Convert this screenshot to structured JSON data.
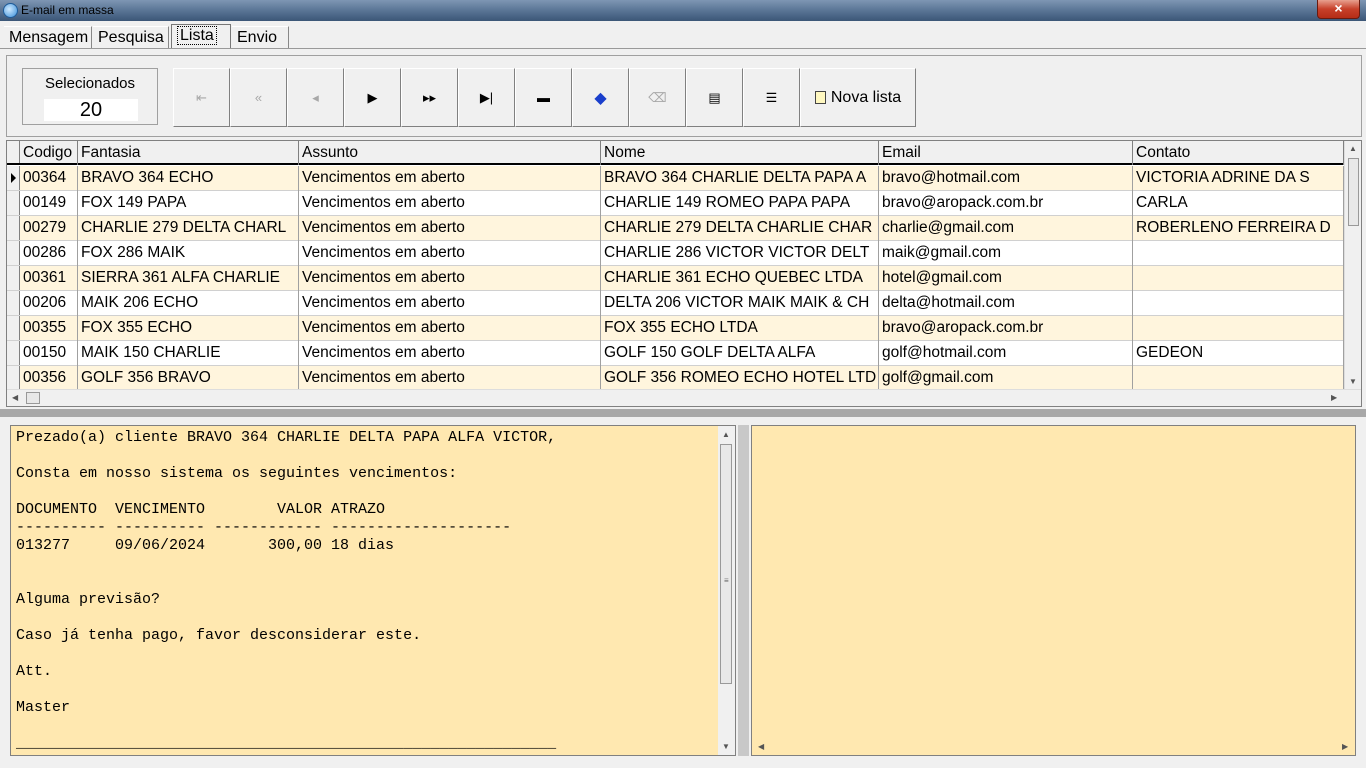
{
  "window": {
    "title": "E-mail em massa",
    "close_glyph": "×"
  },
  "tabs": [
    {
      "label": "Mensagem"
    },
    {
      "label": "Pesquisa"
    },
    {
      "label": "Lista",
      "active": true
    },
    {
      "label": "Envio"
    }
  ],
  "toolbar": {
    "selected_label": "Selecionados",
    "selected_count": "20",
    "nova_lista_label": "Nova lista",
    "buttons": [
      {
        "icon": "first-record-icon",
        "glyph": "⇤",
        "enabled": false
      },
      {
        "icon": "prior-page-icon",
        "glyph": "«",
        "enabled": false
      },
      {
        "icon": "prior-record-icon",
        "glyph": "◂",
        "enabled": false
      },
      {
        "icon": "next-record-icon",
        "glyph": "▶",
        "enabled": true
      },
      {
        "icon": "next-page-icon",
        "glyph": "▸▸",
        "enabled": true
      },
      {
        "icon": "last-record-icon",
        "glyph": "▶|",
        "enabled": true
      },
      {
        "icon": "delete-icon",
        "glyph": "▬",
        "enabled": true
      },
      {
        "icon": "tag-icon",
        "glyph": "◆",
        "enabled": true
      },
      {
        "icon": "eraser-icon",
        "glyph": "⌫",
        "enabled": false
      },
      {
        "icon": "form-view-icon",
        "glyph": "▤",
        "enabled": true
      },
      {
        "icon": "list-view-icon",
        "glyph": "☰",
        "enabled": true
      }
    ]
  },
  "grid": {
    "columns": [
      "Codigo",
      "Fantasia",
      "Assunto",
      "Nome",
      "Email",
      "Contato"
    ],
    "rows": [
      [
        "00364",
        "BRAVO 364 ECHO",
        "Vencimentos em aberto",
        "BRAVO 364 CHARLIE DELTA PAPA A",
        "bravo@hotmail.com",
        "VICTORIA ADRINE DA S"
      ],
      [
        "00149",
        "FOX 149 PAPA",
        "Vencimentos em aberto",
        "CHARLIE 149 ROMEO PAPA PAPA",
        "bravo@aropack.com.br",
        "CARLA"
      ],
      [
        "00279",
        "CHARLIE 279 DELTA CHARL",
        "Vencimentos em aberto",
        "CHARLIE 279 DELTA CHARLIE CHAR",
        "charlie@gmail.com",
        "ROBERLENO FERREIRA D"
      ],
      [
        "00286",
        "FOX 286 MAIK",
        "Vencimentos em aberto",
        "CHARLIE 286 VICTOR VICTOR DELT",
        "maik@gmail.com",
        ""
      ],
      [
        "00361",
        "SIERRA 361 ALFA CHARLIE",
        "Vencimentos em aberto",
        "CHARLIE 361 ECHO QUEBEC LTDA",
        "hotel@gmail.com",
        ""
      ],
      [
        "00206",
        "MAIK 206 ECHO",
        "Vencimentos em aberto",
        "DELTA 206 VICTOR MAIK MAIK & CH",
        "delta@hotmail.com",
        ""
      ],
      [
        "00355",
        "FOX 355 ECHO",
        "Vencimentos em aberto",
        "FOX 355 ECHO LTDA",
        "bravo@aropack.com.br",
        ""
      ],
      [
        "00150",
        "MAIK 150 CHARLIE",
        "Vencimentos em aberto",
        "GOLF 150 GOLF DELTA ALFA",
        "golf@hotmail.com",
        "GEDEON"
      ],
      [
        "00356",
        "GOLF 356 BRAVO",
        "Vencimentos em aberto",
        "GOLF 356 ROMEO ECHO HOTEL LTD",
        "golf@gmail.com",
        ""
      ]
    ]
  },
  "message": {
    "body": "Prezado(a) cliente BRAVO 364 CHARLIE DELTA PAPA ALFA VICTOR,\n\nConsta em nosso sistema os seguintes vencimentos:\n\nDOCUMENTO  VENCIMENTO        VALOR ATRAZO\n---------- ---------- ------------ --------------------\n013277     09/06/2024       300,00 18 dias\n\n\nAlguma previsão?\n\nCaso já tenha pago, favor desconsiderar este.\n\nAtt.\n\nMaster\n\n____________________________________________________________"
  },
  "colors": {
    "row_odd": "#fff5dd",
    "message_bg": "#ffe8b0",
    "titlebar": "#5d7898"
  }
}
